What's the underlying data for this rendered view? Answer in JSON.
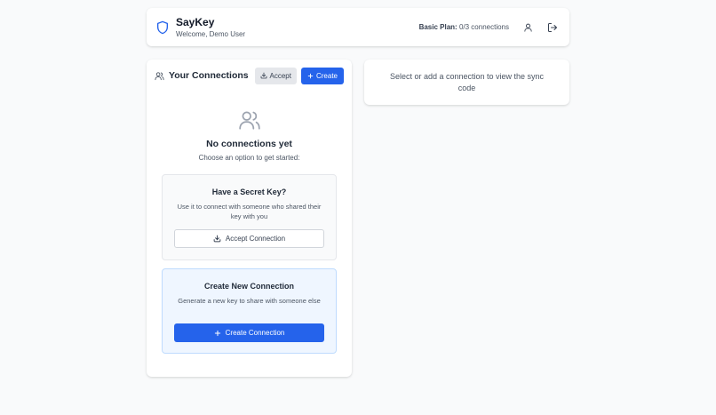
{
  "colors": {
    "accent": "#2563eb",
    "page_bg": "#f9fafb",
    "card_bg": "#ffffff",
    "muted_text": "#4b5563",
    "info_box_bg": "#eff6ff"
  },
  "header": {
    "app_name": "SayKey",
    "welcome": "Welcome, Demo User",
    "plan_label": "Basic Plan:",
    "plan_usage": "0/3 connections",
    "icons": [
      "shield-icon",
      "user-icon",
      "logout-icon"
    ]
  },
  "connections": {
    "title": "Your Connections",
    "accept_label": "Accept",
    "create_label": "Create",
    "empty_title": "No connections yet",
    "empty_sub": "Choose an option to get started:",
    "secret_key": {
      "title": "Have a Secret Key?",
      "description": "Use it to connect with someone who shared their key with you",
      "button": "Accept Connection"
    },
    "create_new": {
      "title": "Create New Connection",
      "description": "Generate a new key to share with someone else",
      "button": "Create Connection"
    }
  },
  "sync_panel": {
    "message": "Select or add a connection to view the sync code"
  }
}
